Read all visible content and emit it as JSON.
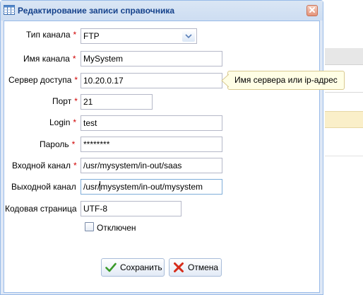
{
  "window": {
    "title": "Редактирование записи справочника",
    "icon": "table-grid-icon",
    "close_icon": "close-icon"
  },
  "form": {
    "channel_type": {
      "label": "Тип канала",
      "required": "*",
      "value": "FTP"
    },
    "channel_name": {
      "label": "Имя канала",
      "required": "*",
      "value": "MySystem"
    },
    "server": {
      "label": "Сервер доступа",
      "required": "*",
      "value": "10.20.0.17"
    },
    "port": {
      "label": "Порт",
      "required": "*",
      "value": "21"
    },
    "login": {
      "label": "Login",
      "required": "*",
      "value": "test"
    },
    "password": {
      "label": "Пароль",
      "required": "*",
      "value": "********"
    },
    "input_channel": {
      "label": "Входной канал",
      "required": "*",
      "value": "/usr/mysystem/in-out/saas"
    },
    "output_channel": {
      "label": "Выходной канал",
      "value_before_cursor": "/usr/",
      "value_after_cursor": "mysystem/in-out/mysystem"
    },
    "codepage": {
      "label": "Кодовая страница",
      "value": "UTF-8"
    },
    "disabled": {
      "label": "Отключен",
      "checked": false
    }
  },
  "tooltip": {
    "text": "Имя сервера или ip-адрес"
  },
  "buttons": {
    "save": "Сохранить",
    "cancel": "Отмена"
  },
  "colors": {
    "title_text": "#15428b",
    "frame": "#dfe8f6",
    "border": "#99bbe8",
    "required": "#d00000",
    "tooltip_bg": "#fffee5"
  }
}
